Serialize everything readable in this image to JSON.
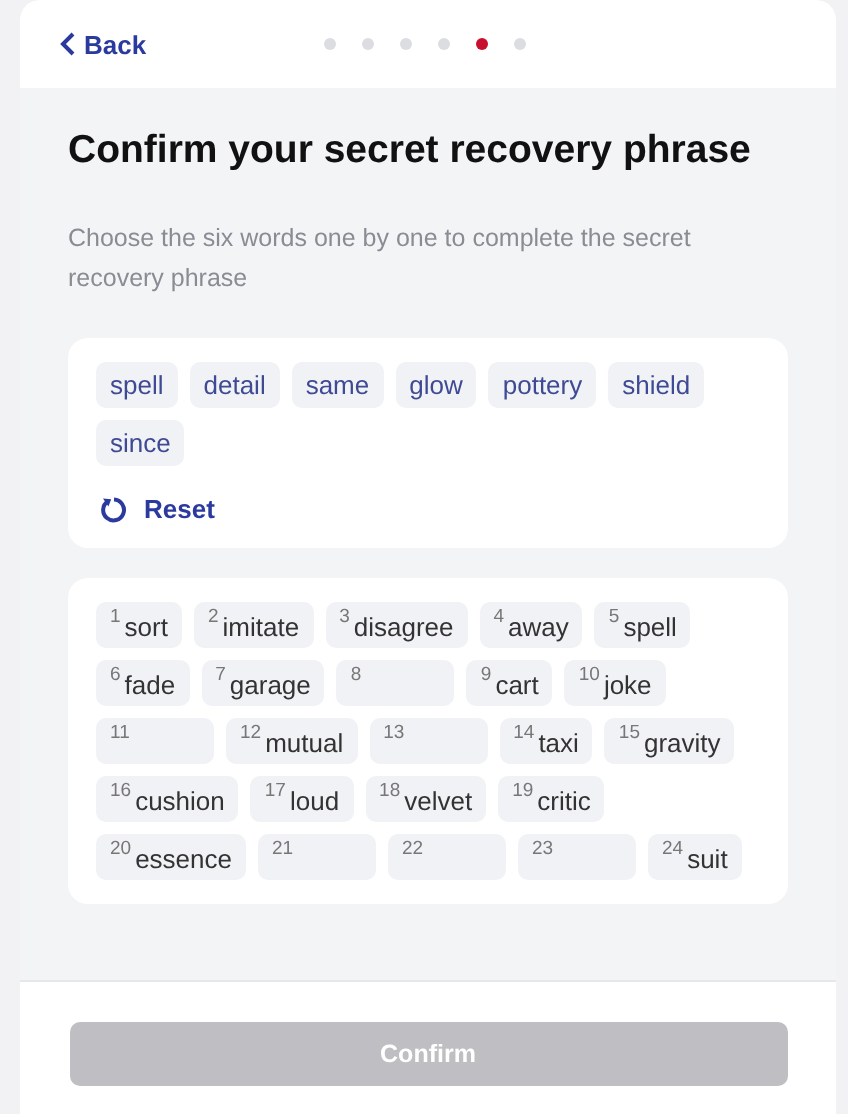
{
  "header": {
    "back": "Back",
    "steps": [
      {
        "selected": false
      },
      {
        "selected": false
      },
      {
        "selected": false
      },
      {
        "selected": false
      },
      {
        "selected": true
      },
      {
        "selected": false
      }
    ]
  },
  "title": "Confirm your secret recovery phrase",
  "description": "Choose the six words one by one to complete the secret recovery phrase",
  "choices": [
    "spell",
    "detail",
    "same",
    "glow",
    "pottery",
    "shield",
    "since"
  ],
  "reset": "Reset",
  "slots": [
    {
      "number": "1",
      "word": "sort"
    },
    {
      "number": "2",
      "word": "imitate"
    },
    {
      "number": "3",
      "word": "disagree"
    },
    {
      "number": "4",
      "word": "away"
    },
    {
      "number": "5",
      "word": "spell"
    },
    {
      "number": "6",
      "word": "fade"
    },
    {
      "number": "7",
      "word": "garage"
    },
    {
      "number": "8"
    },
    {
      "number": "9",
      "word": "cart"
    },
    {
      "number": "10",
      "word": "joke"
    },
    {
      "number": "11"
    },
    {
      "number": "12",
      "word": "mutual"
    },
    {
      "number": "13"
    },
    {
      "number": "14",
      "word": "taxi"
    },
    {
      "number": "15",
      "word": "gravity"
    },
    {
      "number": "16",
      "word": "cushion"
    },
    {
      "number": "17",
      "word": "loud"
    },
    {
      "number": "18",
      "word": "velvet"
    },
    {
      "number": "19",
      "word": "critic"
    },
    {
      "number": "20",
      "word": "essence"
    },
    {
      "number": "21"
    },
    {
      "number": "22"
    },
    {
      "number": "23"
    },
    {
      "number": "24",
      "word": "suit"
    }
  ],
  "confirm": {
    "label": "Confirm",
    "disabled": true
  }
}
